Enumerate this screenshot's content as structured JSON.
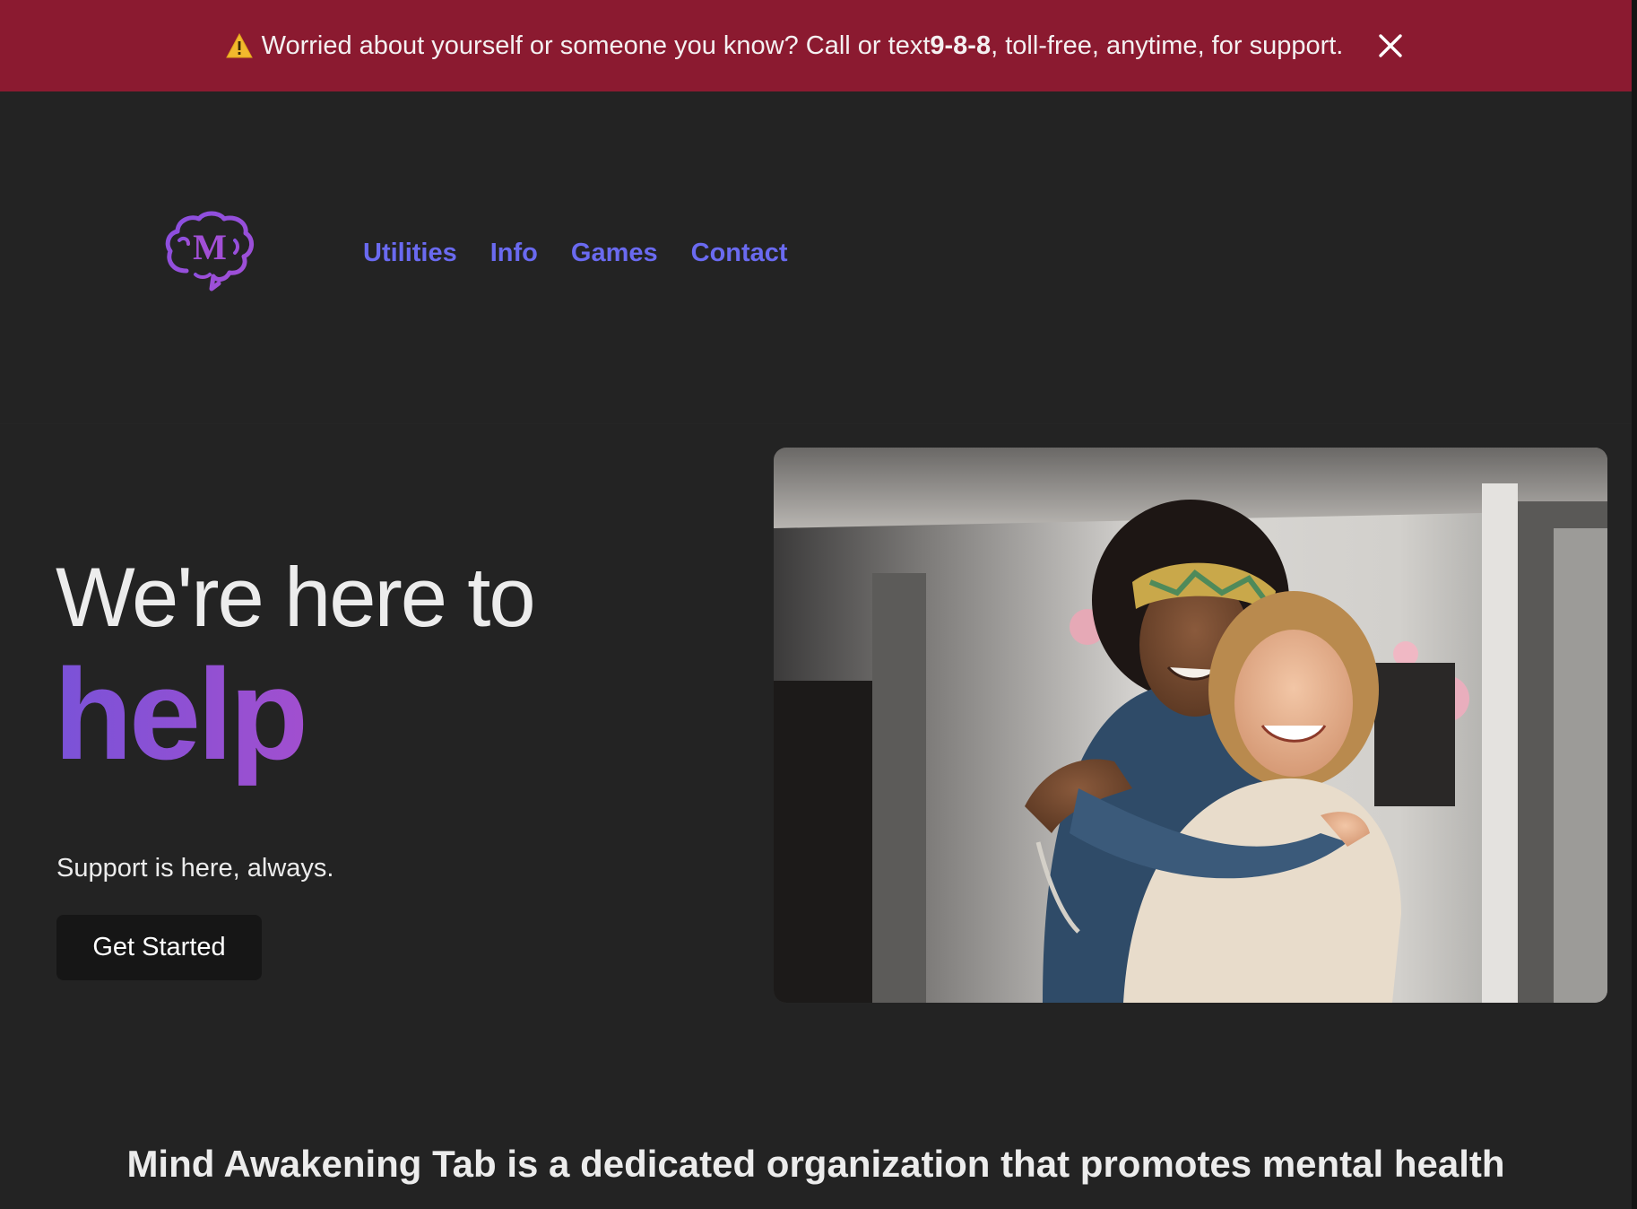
{
  "alert": {
    "icon": "warning-icon",
    "text_before": "Worried about yourself or someone you know? Call or text ",
    "phone": "9-8-8",
    "text_after": ", toll-free, anytime, for support.",
    "close_icon": "close-icon",
    "background": "#8b1a30"
  },
  "header": {
    "logo_icon": "brain-logo-icon",
    "logo_letter": "M",
    "nav": [
      {
        "label": "Utilities"
      },
      {
        "label": "Info"
      },
      {
        "label": "Games"
      },
      {
        "label": "Contact"
      }
    ],
    "nav_color": "#6a6af0"
  },
  "hero": {
    "line1": "We're here to",
    "line2": "help",
    "subtitle": "Support is here, always.",
    "cta_label": "Get Started",
    "accent_gradient": [
      "#7a52d8",
      "#a14fcf"
    ]
  },
  "mission": {
    "text": "Mind Awakening Tab is a dedicated organization that promotes mental health"
  },
  "colors": {
    "background": "#232323",
    "text": "#ececec"
  }
}
